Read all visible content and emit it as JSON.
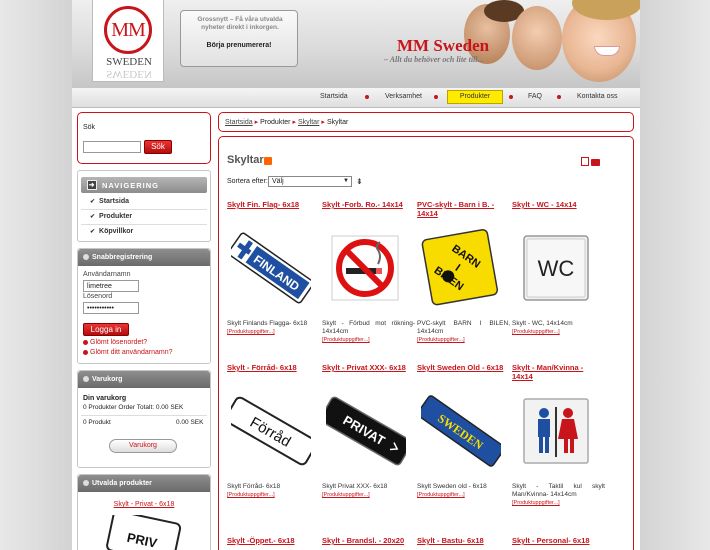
{
  "header": {
    "logo_initials": "MM",
    "logo_name": "SWEDEN",
    "news_text": "Grossnytt – Få våra utvalda nyheter direkt i inkorgen.",
    "news_subscribe": "Börja prenumerera!",
    "brand": "MM Sweden",
    "tagline": "– Allt du behöver och lite till..."
  },
  "menu": {
    "items": [
      "Startsida",
      "Verksamhet",
      "Produkter",
      "FAQ",
      "Kontakta oss"
    ],
    "active": "Produkter"
  },
  "search": {
    "label": "Sök",
    "value": "",
    "button": "Sök"
  },
  "navigation": {
    "title": "NAVIGERING",
    "items": [
      "Startsida",
      "Produkter",
      "Köpvillkor"
    ]
  },
  "login": {
    "title": "Snabbregistrering",
    "user_label": "Användarnamn",
    "user_value": "limetree",
    "password_label": "Lösenord",
    "password_value": "•••••••••••",
    "button": "Logga in",
    "forgot_password": "Glömt lösenordet?",
    "forgot_username": "Glömt ditt användarnamn?"
  },
  "cart": {
    "title": "Varukorg",
    "heading": "Din varukorg",
    "summary": "0 Produkter Order Totalt: 0.00 SEK",
    "count_label": "0 Produkt",
    "total": "0.00 SEK",
    "button": "Varukorg"
  },
  "featured": {
    "title": "Utvalda produkter",
    "item": "Skylt - Privat - 6x18"
  },
  "breadcrumb": {
    "items": [
      "Startsida",
      "Produkter",
      "Skyltar",
      "Skyltar"
    ]
  },
  "content": {
    "title": "Skyltar",
    "sort_label": "Sortera efter:",
    "sort_value": "Välj",
    "sort_icon": "⇟"
  },
  "more_label": "[Produktuppgifter...]",
  "products": [
    {
      "title": "Skylt Fin. Flag- 6x18",
      "desc": "Skylt Finlands Flagga- 6x18",
      "icon": "finland-sign-icon"
    },
    {
      "title": "Skylt -Forb. Ro.- 14x14",
      "desc": "Skylt - Förbud mot rökning- 14x14cm",
      "icon": "no-smoking-sign-icon"
    },
    {
      "title": "PVC-skylt - Barn i B. - 14x14",
      "desc": "PVC-skylt BARN I BILEN, 14x14cm",
      "icon": "baby-in-car-sign-icon"
    },
    {
      "title": "Skylt - WC - 14x14",
      "desc": "Skylt - WC, 14x14cm",
      "icon": "wc-sign-icon"
    },
    {
      "title": "Skylt - Förråd- 6x18",
      "desc": "Skylt Förråd- 6x18",
      "icon": "forrad-sign-icon"
    },
    {
      "title": "Skylt - Privat XXX- 6x18",
      "desc": "Skylt Privat XXX- 6x18",
      "icon": "privat-sign-icon"
    },
    {
      "title": "Skylt Sweden Old - 6x18",
      "desc": "Skylt Sweden old - 6x18",
      "icon": "sweden-sign-icon"
    },
    {
      "title": "Skylt - Man/Kvinna - 14x14",
      "desc": "Skylt - Taktil kul skylt Man/Kvinna- 14x14cm",
      "icon": "man-woman-sign-icon"
    },
    {
      "title": "Skylt -Öppet.- 6x18",
      "desc": "",
      "icon": ""
    },
    {
      "title": "Skylt - Brandsl. - 20x20",
      "desc": "",
      "icon": ""
    },
    {
      "title": "Skylt - Bastu- 6x18",
      "desc": "",
      "icon": ""
    },
    {
      "title": "Skylt - Personal- 6x18",
      "desc": "",
      "icon": ""
    }
  ],
  "sign_text": {
    "finland": "FINLAND",
    "no_smoking": "",
    "baby_line1": "BARN",
    "baby_line2": "I",
    "baby_line3": "BILEN",
    "wc": "WC",
    "forrad": "Förråd",
    "privat": "PRIVAT",
    "sweden": "SWEDEN",
    "featured_sign": "PRIV"
  },
  "colors": {
    "accent_red": "#c8141b",
    "menu_active": "#ffeb00"
  }
}
